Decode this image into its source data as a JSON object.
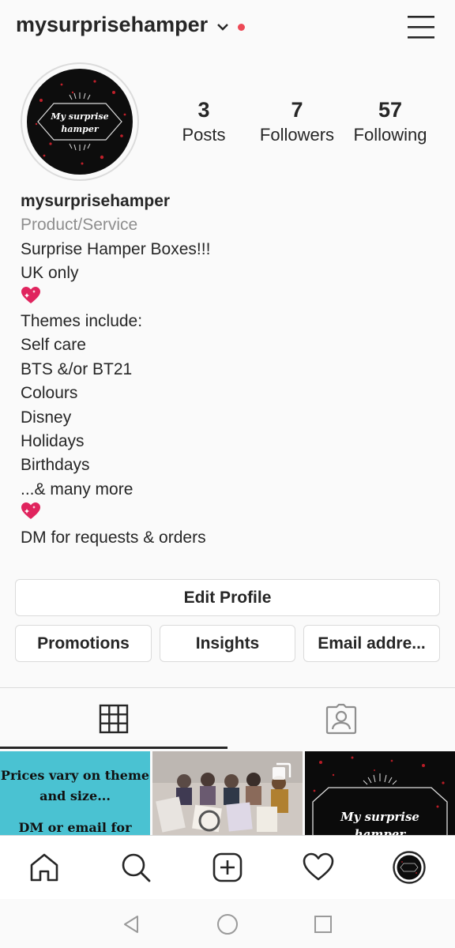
{
  "header": {
    "username": "mysurprisehamper",
    "account_switch_icon": "chevron-down-icon",
    "notification_dot_color": "#ed4956",
    "menu_icon": "hamburger-menu-icon"
  },
  "profile": {
    "avatar_text_line1": "My surprise",
    "avatar_text_line2": "hamper",
    "stats": [
      {
        "value": "3",
        "label": "Posts"
      },
      {
        "value": "7",
        "label": "Followers"
      },
      {
        "value": "57",
        "label": "Following"
      }
    ],
    "name": "mysurprisehamper",
    "category": "Product/Service",
    "bio_lines": [
      "Surprise Hamper Boxes!!!",
      "UK only",
      "",
      "Themes include:",
      "Self care",
      "BTS &/or BT21",
      "Colours",
      "Disney",
      "Holidays",
      "Birthdays",
      "...& many more",
      "",
      "DM for requests & orders"
    ]
  },
  "buttons": {
    "edit_profile": "Edit Profile",
    "promotions": "Promotions",
    "insights": "Insights",
    "email": "Email addre..."
  },
  "tabs": [
    {
      "icon": "grid-icon",
      "active": true
    },
    {
      "icon": "tagged-person-icon",
      "active": false
    }
  ],
  "grid": {
    "tile1_text_line1": "Prices vary on theme",
    "tile1_text_line2": "and size...",
    "tile1_text_line3": "DM or email for",
    "tile2_icon": "multiple-photos-icon",
    "tile3_text_line1": "My surprise",
    "tile3_text_line2": "hamper"
  },
  "bottom_nav": [
    "home-icon",
    "search-icon",
    "add-post-icon",
    "activity-heart-icon",
    "profile-avatar-icon"
  ],
  "system_nav": [
    "back-icon",
    "home-circle-icon",
    "recents-square-icon"
  ],
  "colors": {
    "text": "#262626",
    "muted": "#8e8e8e",
    "border": "#dbdbdb",
    "accent_red": "#ed4956",
    "tile_teal": "#4ac2d2"
  }
}
